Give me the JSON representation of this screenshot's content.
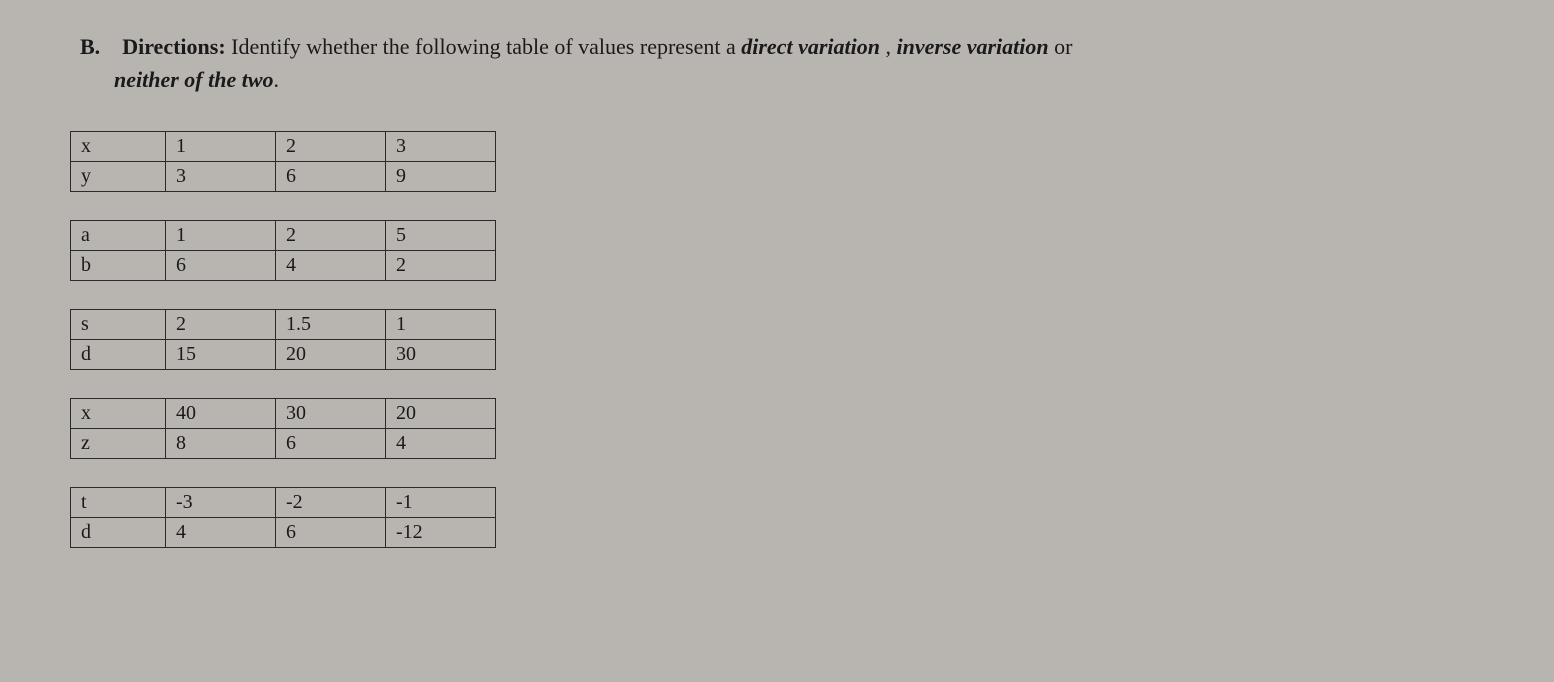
{
  "directions": {
    "marker": "B.",
    "label": "Directions:",
    "text_part1": " Identify whether the following table of values represent a ",
    "term1": "direct variation",
    "text_part2": ", ",
    "term2": "inverse variation",
    "text_part3": " or",
    "term3": "neither of the two",
    "text_part4": "."
  },
  "tables": [
    {
      "rows": [
        {
          "var": "x",
          "c1": "1",
          "c2": "2",
          "c3": "3"
        },
        {
          "var": "y",
          "c1": "3",
          "c2": "6",
          "c3": "9"
        }
      ]
    },
    {
      "rows": [
        {
          "var": "a",
          "c1": "1",
          "c2": "2",
          "c3": "5"
        },
        {
          "var": "b",
          "c1": "6",
          "c2": "4",
          "c3": "2"
        }
      ]
    },
    {
      "rows": [
        {
          "var": "s",
          "c1": "2",
          "c2": "1.5",
          "c3": "1"
        },
        {
          "var": "d",
          "c1": "15",
          "c2": "20",
          "c3": "30"
        }
      ]
    },
    {
      "rows": [
        {
          "var": "x",
          "c1": "40",
          "c2": "30",
          "c3": "20"
        },
        {
          "var": "z",
          "c1": "8",
          "c2": "6",
          "c3": "4"
        }
      ]
    },
    {
      "rows": [
        {
          "var": "t",
          "c1": "-3",
          "c2": "-2",
          "c3": "-1"
        },
        {
          "var": "d",
          "c1": "4",
          "c2": "6",
          "c3": "-12"
        }
      ]
    }
  ]
}
